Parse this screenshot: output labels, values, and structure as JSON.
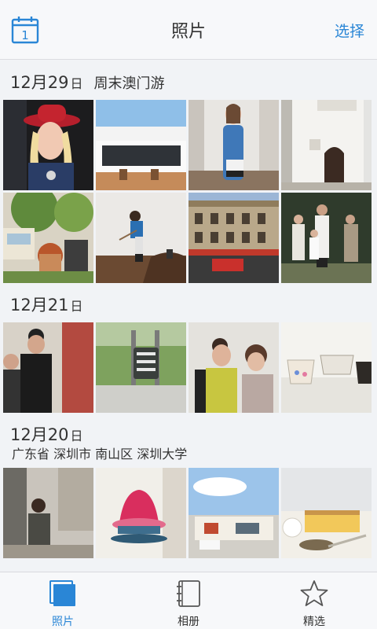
{
  "header": {
    "title": "照片",
    "select_label": "选择",
    "calendar_day": "1"
  },
  "sections": [
    {
      "date_num": "12月29",
      "day_suffix": "日",
      "location": "周末澳门游",
      "photos": [
        {
          "desc": "portrait"
        },
        {
          "desc": "building"
        },
        {
          "desc": "portrait"
        },
        {
          "desc": "building"
        },
        {
          "desc": "garden"
        },
        {
          "desc": "worker"
        },
        {
          "desc": "building"
        },
        {
          "desc": "family"
        }
      ]
    },
    {
      "date_num": "12月21",
      "day_suffix": "日",
      "location": "",
      "photos": [
        {
          "desc": "people"
        },
        {
          "desc": "sign"
        },
        {
          "desc": "people"
        },
        {
          "desc": "cups"
        }
      ]
    },
    {
      "date_num": "12月20",
      "day_suffix": "日",
      "location": "",
      "subtitle": "广东省 深圳市 南山区 深圳大学",
      "photos": [
        {
          "desc": "street"
        },
        {
          "desc": "dessert"
        },
        {
          "desc": "house"
        },
        {
          "desc": "cake"
        }
      ]
    }
  ],
  "tabs": [
    {
      "label": "照片",
      "icon": "photos-icon",
      "active": true
    },
    {
      "label": "相册",
      "icon": "album-icon",
      "active": false
    },
    {
      "label": "精选",
      "icon": "star-icon",
      "active": false
    }
  ],
  "colors": {
    "accent": "#2a86d6",
    "bar_bg": "#f7f8fa",
    "page_bg": "#f1f3f6"
  }
}
